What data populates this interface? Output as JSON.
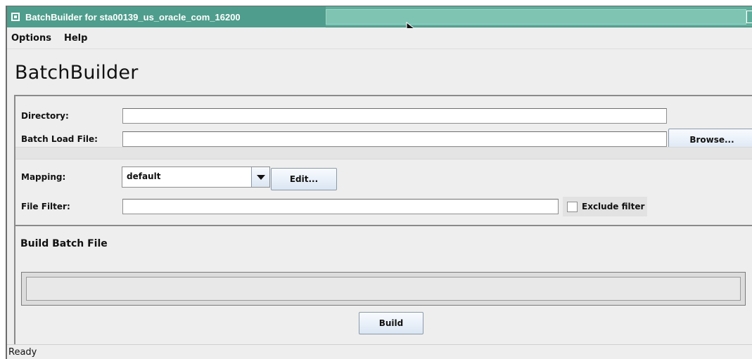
{
  "window": {
    "title": "BatchBuilder for sta00139_us_oracle_com_16200",
    "accent_color": "#5fae9c"
  },
  "menubar": {
    "items": [
      {
        "label": "Options"
      },
      {
        "label": "Help"
      }
    ]
  },
  "app": {
    "heading": "BatchBuilder"
  },
  "form": {
    "directory_label": "Directory:",
    "directory_value": "",
    "batch_load_label": "Batch Load File:",
    "batch_load_value": "",
    "browse_label": "Browse...",
    "mapping_label": "Mapping:",
    "mapping_value": "default",
    "edit_label": "Edit...",
    "filter_label": "File Filter:",
    "filter_value": "",
    "exclude_filter_label": "Exclude filter",
    "exclude_filter_checked": false
  },
  "build": {
    "section_title": "Build Batch File",
    "build_label": "Build"
  },
  "status": {
    "text": "Ready"
  }
}
